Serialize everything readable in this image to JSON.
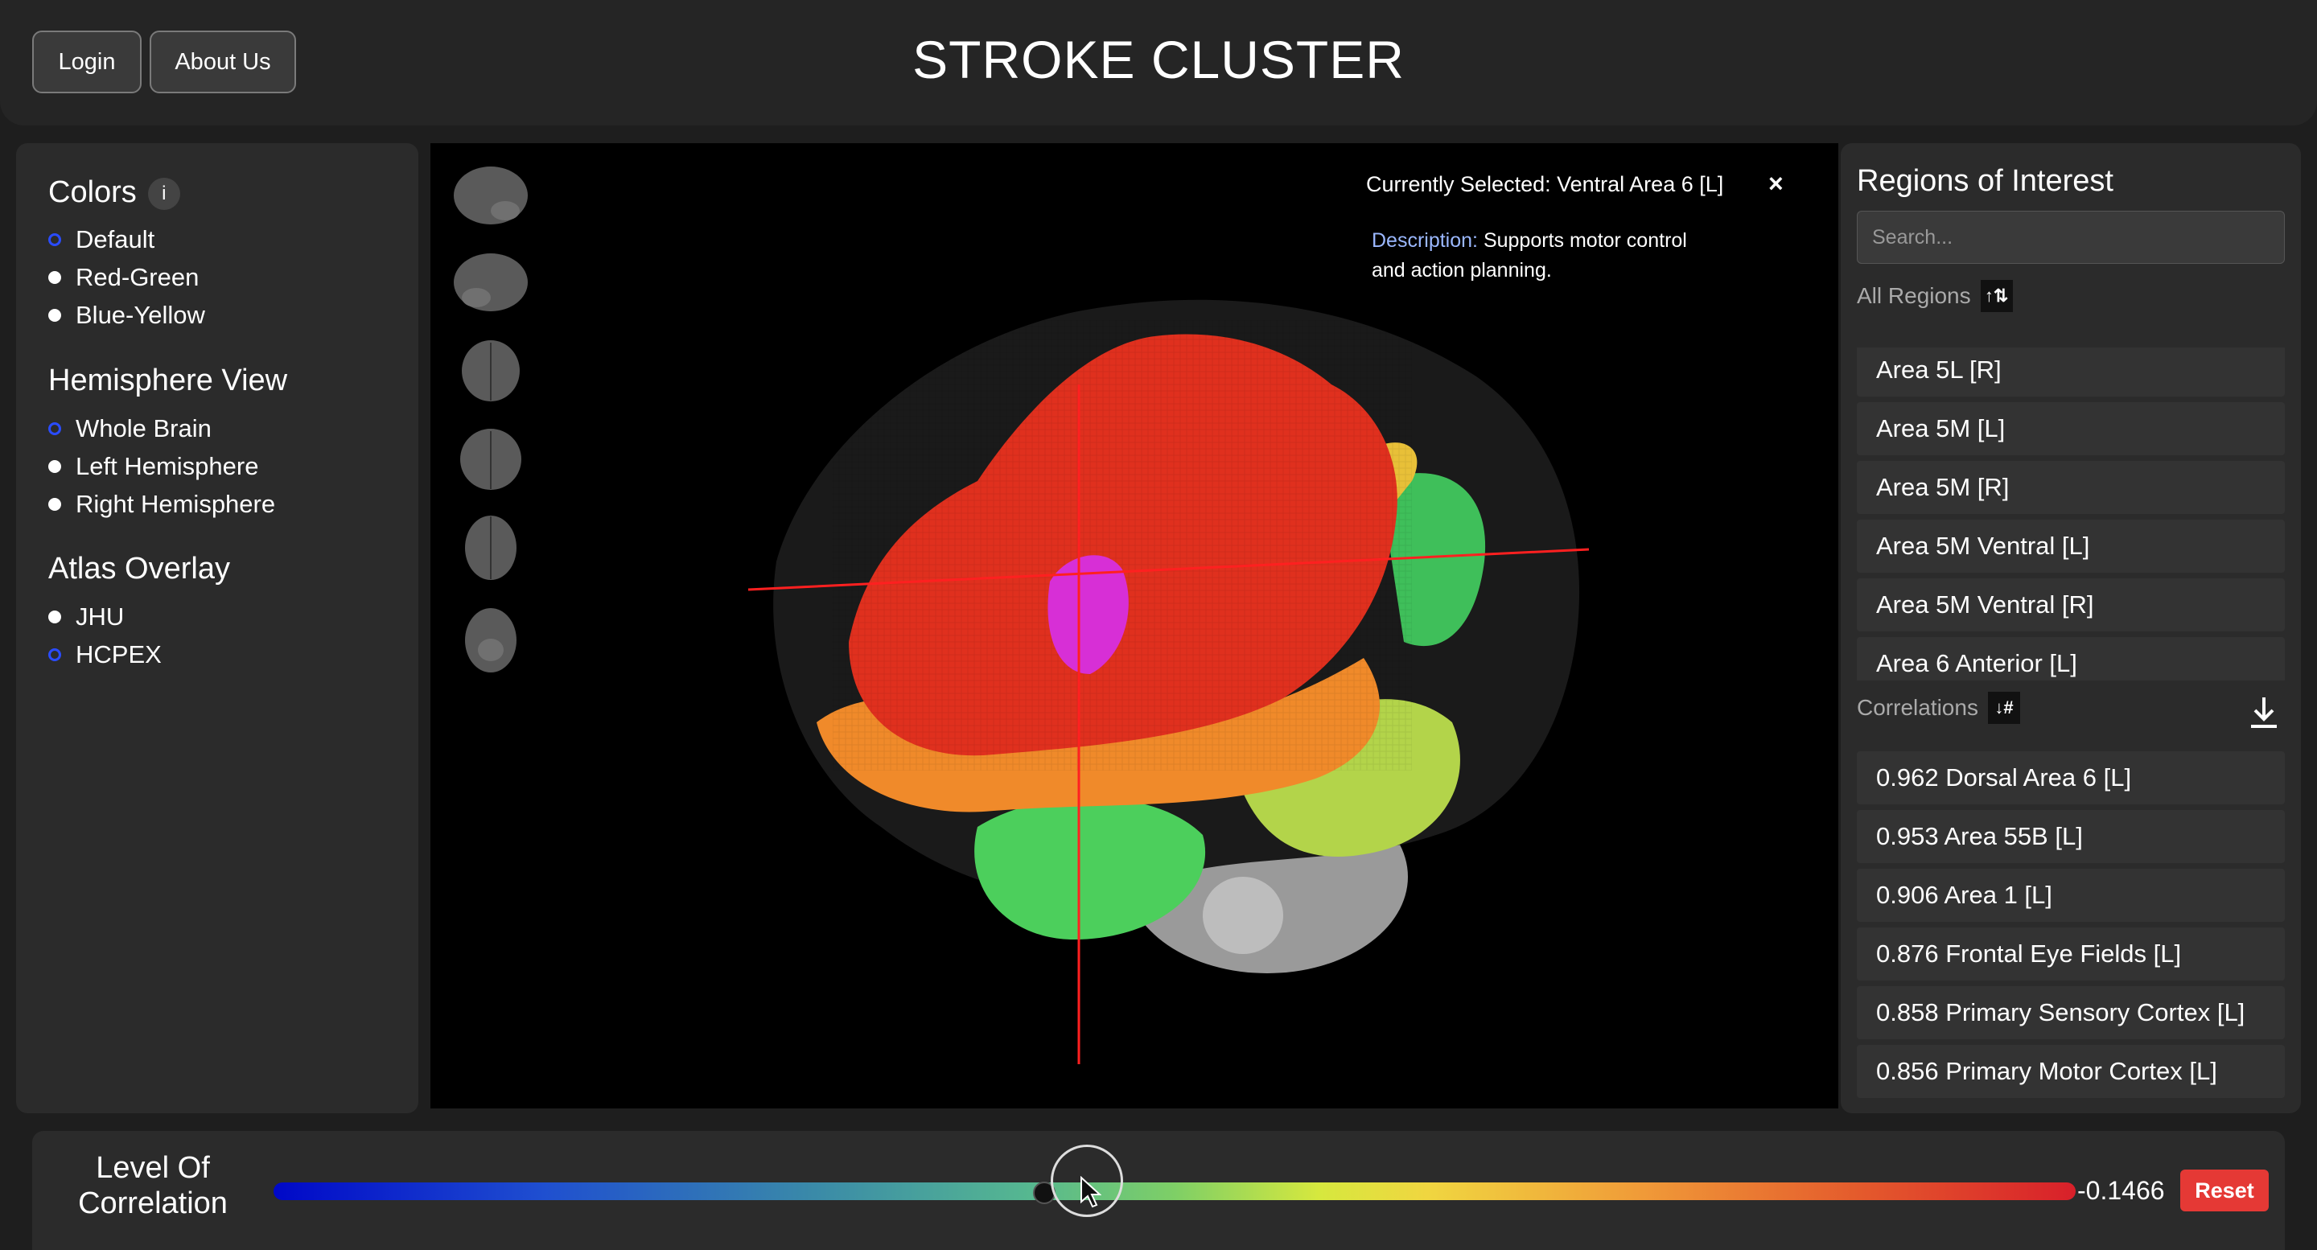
{
  "header": {
    "login_label": "Login",
    "about_label": "About Us",
    "title": "STROKE CLUSTER"
  },
  "left_panel": {
    "colors": {
      "title": "Colors",
      "info": "i",
      "options": [
        "Default",
        "Red-Green",
        "Blue-Yellow"
      ],
      "selected": "Default"
    },
    "hemisphere": {
      "title": "Hemisphere View",
      "options": [
        "Whole Brain",
        "Left Hemisphere",
        "Right Hemisphere"
      ],
      "selected": "Whole Brain"
    },
    "atlas": {
      "title": "Atlas Overlay",
      "options": [
        "JHU",
        "HCPEX"
      ],
      "selected": "HCPEX"
    }
  },
  "viewer": {
    "selected_label": "Currently Selected: Ventral Area 6 [L]",
    "close_icon": "×",
    "description_label": "Description:",
    "description_text": "Supports motor control",
    "description_text_2": "and action planning."
  },
  "right_panel": {
    "title": "Regions of Interest",
    "search_placeholder": "Search...",
    "all_regions_label": "All Regions",
    "all_regions_sort_icon": "↑⇅",
    "regions": [
      "Area 5L [R]",
      "Area 5M [L]",
      "Area 5M [R]",
      "Area 5M Ventral [L]",
      "Area 5M Ventral [R]",
      "Area 6 Anterior [L]"
    ],
    "correlations_label": "Correlations",
    "correlations_sort_icon": "↓#",
    "correlations": [
      "0.962 Dorsal Area 6 [L]",
      "0.953 Area 55B [L]",
      "0.906 Area 1 [L]",
      "0.876 Frontal Eye Fields [L]",
      "0.858 Primary Sensory Cortex [L]",
      "0.856 Primary Motor Cortex [L]"
    ]
  },
  "bottom": {
    "level_label_1": "Level Of",
    "level_label_2": "Correlation",
    "value": "-0.1466",
    "reset_label": "Reset",
    "slider_fraction": 0.427
  }
}
